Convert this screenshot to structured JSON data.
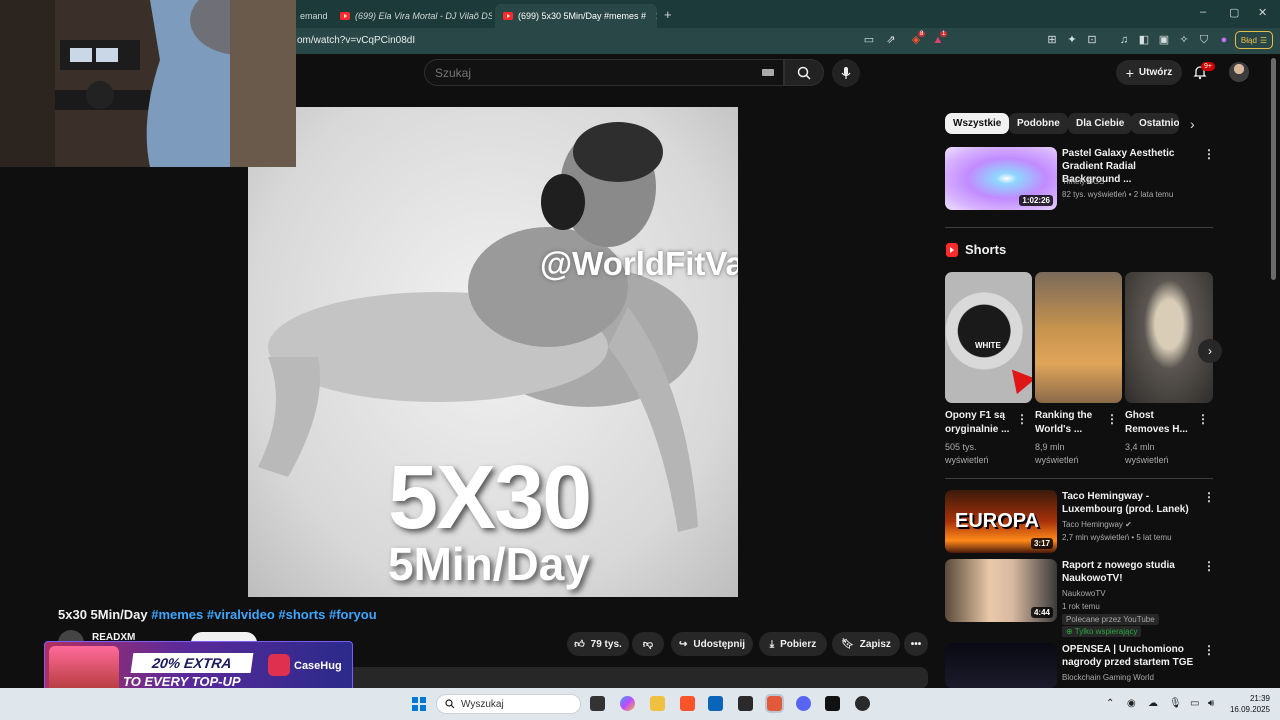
{
  "browser": {
    "tabs": [
      {
        "label": "emand"
      },
      {
        "label": "(699) Ela Vira Mortal - DJ Vilaõ DS"
      },
      {
        "label": "(699) 5x30 5Min/Day #memes #"
      }
    ],
    "new_tab": "+",
    "window_controls": {
      "minimize": "–",
      "maximize": "▢",
      "close": "✕"
    },
    "url": "om/watch?v=vCqPCin08dI",
    "error_button": "Błąd",
    "extension_badges": {
      "brave_count": "8",
      "alert_count": "1"
    }
  },
  "youtube_header": {
    "search_placeholder": "Szukaj",
    "create_label": "Utwórz",
    "notifications_badge": "9+"
  },
  "video": {
    "watermark": "@WorldFitVa",
    "overlay_big": "5X30",
    "overlay_sub": "5Min/Day",
    "title_main": "5x30 5Min/Day",
    "title_tags": " #memes #viralvideo #shorts #foryou",
    "channel_name": "READXM",
    "actions": {
      "likes": "79 tys.",
      "share": "Udostępnij",
      "download": "Pobierz",
      "save": "Zapisz",
      "more": "•••"
    }
  },
  "ad": {
    "headline": "20% EXTRA",
    "line2": "TO EVERY TOP-UP",
    "brand": "CaseHug"
  },
  "sidebar": {
    "chips": [
      "Wszystkie",
      "Podobne",
      "Dla Ciebie",
      "Ostatnio"
    ],
    "chip_next": "›",
    "recommended_top": {
      "title": "Pastel Galaxy Aesthetic Gradient Radial Background ...",
      "channel": "Timely BGS",
      "meta": "82 tys. wyświetleń • 2 lata temu",
      "duration": "1:02:26"
    },
    "shorts_heading": "Shorts",
    "shorts": [
      {
        "title": "Opony F1 są oryginalnie ...",
        "views": "505 tys.",
        "views_label": "wyświetleń",
        "overlay": "WHITE"
      },
      {
        "title": "Ranking the World's ...",
        "views": "8,9 mln",
        "views_label": "wyświetleń",
        "overlay": ""
      },
      {
        "title": "Ghost Removes H...",
        "views": "3,4 mln",
        "views_label": "wyświetleń",
        "overlay": ""
      }
    ],
    "shorts_next": "›",
    "videos": [
      {
        "title": "Taco Hemingway - Luxembourg (prod. Lanek)",
        "channel": "Taco Hemingway",
        "verified": "✔",
        "meta": "2,7 mln wyświetleń • 5 lat temu",
        "duration": "3:17",
        "thumb_text": "EUROPA"
      },
      {
        "title": "Raport z nowego studia NaukowoTV!",
        "channel": "NaukowoTV",
        "meta": "1 rok temu",
        "badge": "Polecane przez YouTube",
        "support": "⊕ Tylko wspierający",
        "duration": "4:44"
      },
      {
        "title": "OPENSEA | Uruchomiono nagrody przed startem TGE",
        "channel": "Blockchain Gaming World"
      }
    ]
  },
  "taskbar": {
    "search_placeholder": "Wyszukaj",
    "time": "21:39",
    "date": "16.09.2025"
  }
}
